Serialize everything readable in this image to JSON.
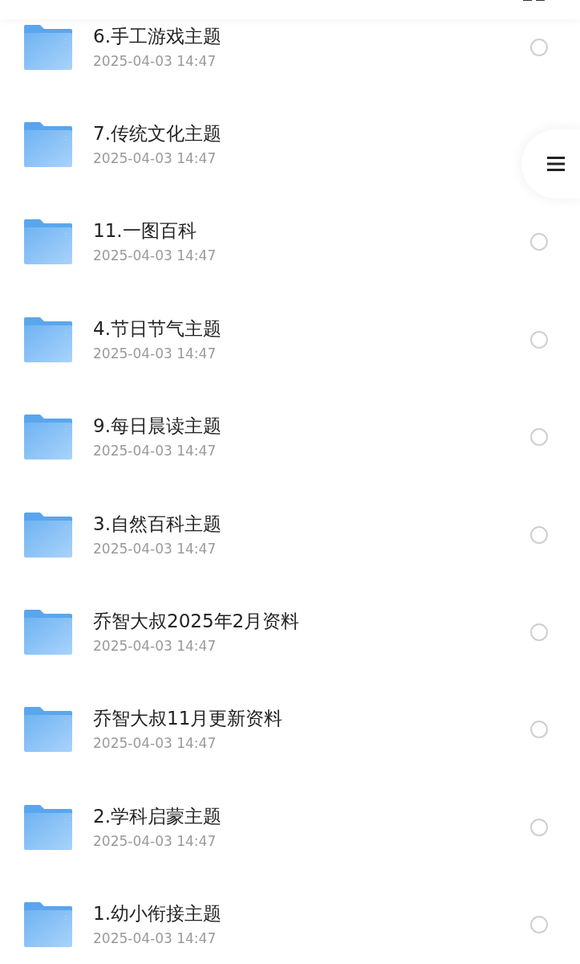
{
  "files": [
    {
      "name": "6.手工游戏主题",
      "date": "2025-04-03 14:47",
      "checked": false
    },
    {
      "name": "7.传统文化主题",
      "date": "2025-04-03 14:47"
    },
    {
      "name": "11.一图百科",
      "date": "2025-04-03 14:47",
      "checked": false
    },
    {
      "name": "4.节日节气主题",
      "date": "2025-04-03 14:47",
      "checked": false
    },
    {
      "name": "9.每日晨读主题",
      "date": "2025-04-03 14:47",
      "checked": false
    },
    {
      "name": "3.自然百科主题",
      "date": "2025-04-03 14:47",
      "checked": false
    },
    {
      "name": "乔智大叔2025年2月资料",
      "date": "2025-04-03 14:47",
      "checked": false
    },
    {
      "name": "乔智大叔11月更新资料",
      "date": "2025-04-03 14:47",
      "checked": false
    },
    {
      "name": "2.学科启蒙主题",
      "date": "2025-04-03 14:47",
      "checked": false
    },
    {
      "name": "1.幼小衔接主题",
      "date": "2025-04-03 14:47",
      "checked": false
    }
  ]
}
